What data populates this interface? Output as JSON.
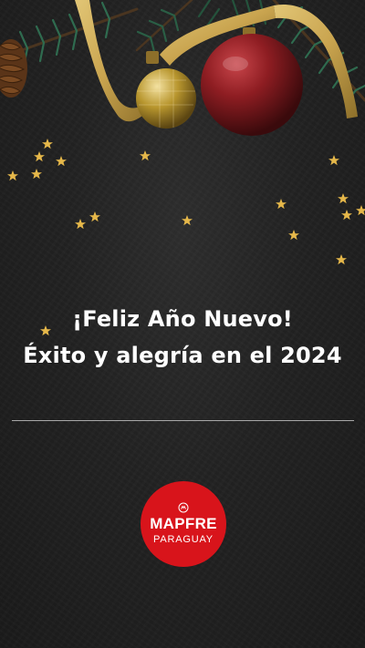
{
  "greeting": {
    "line1": "¡Feliz Año Nuevo!",
    "line2": "Éxito y alegría en el 2024"
  },
  "logo": {
    "brand": "MAPFRE",
    "country": "PARAGUAY",
    "color": "#d8141b"
  },
  "colors": {
    "background": "#222222",
    "text": "#ffffff",
    "star": "#e6b84a",
    "ribbon": "#c9a44f",
    "ornament_red": "#8e1d22",
    "ornament_gold": "#b8962e"
  },
  "decorations": {
    "icons": [
      "pine-branch-icon",
      "pinecone-icon",
      "gold-ornament-icon",
      "red-ornament-icon",
      "ribbon-icon",
      "star-icon"
    ]
  }
}
